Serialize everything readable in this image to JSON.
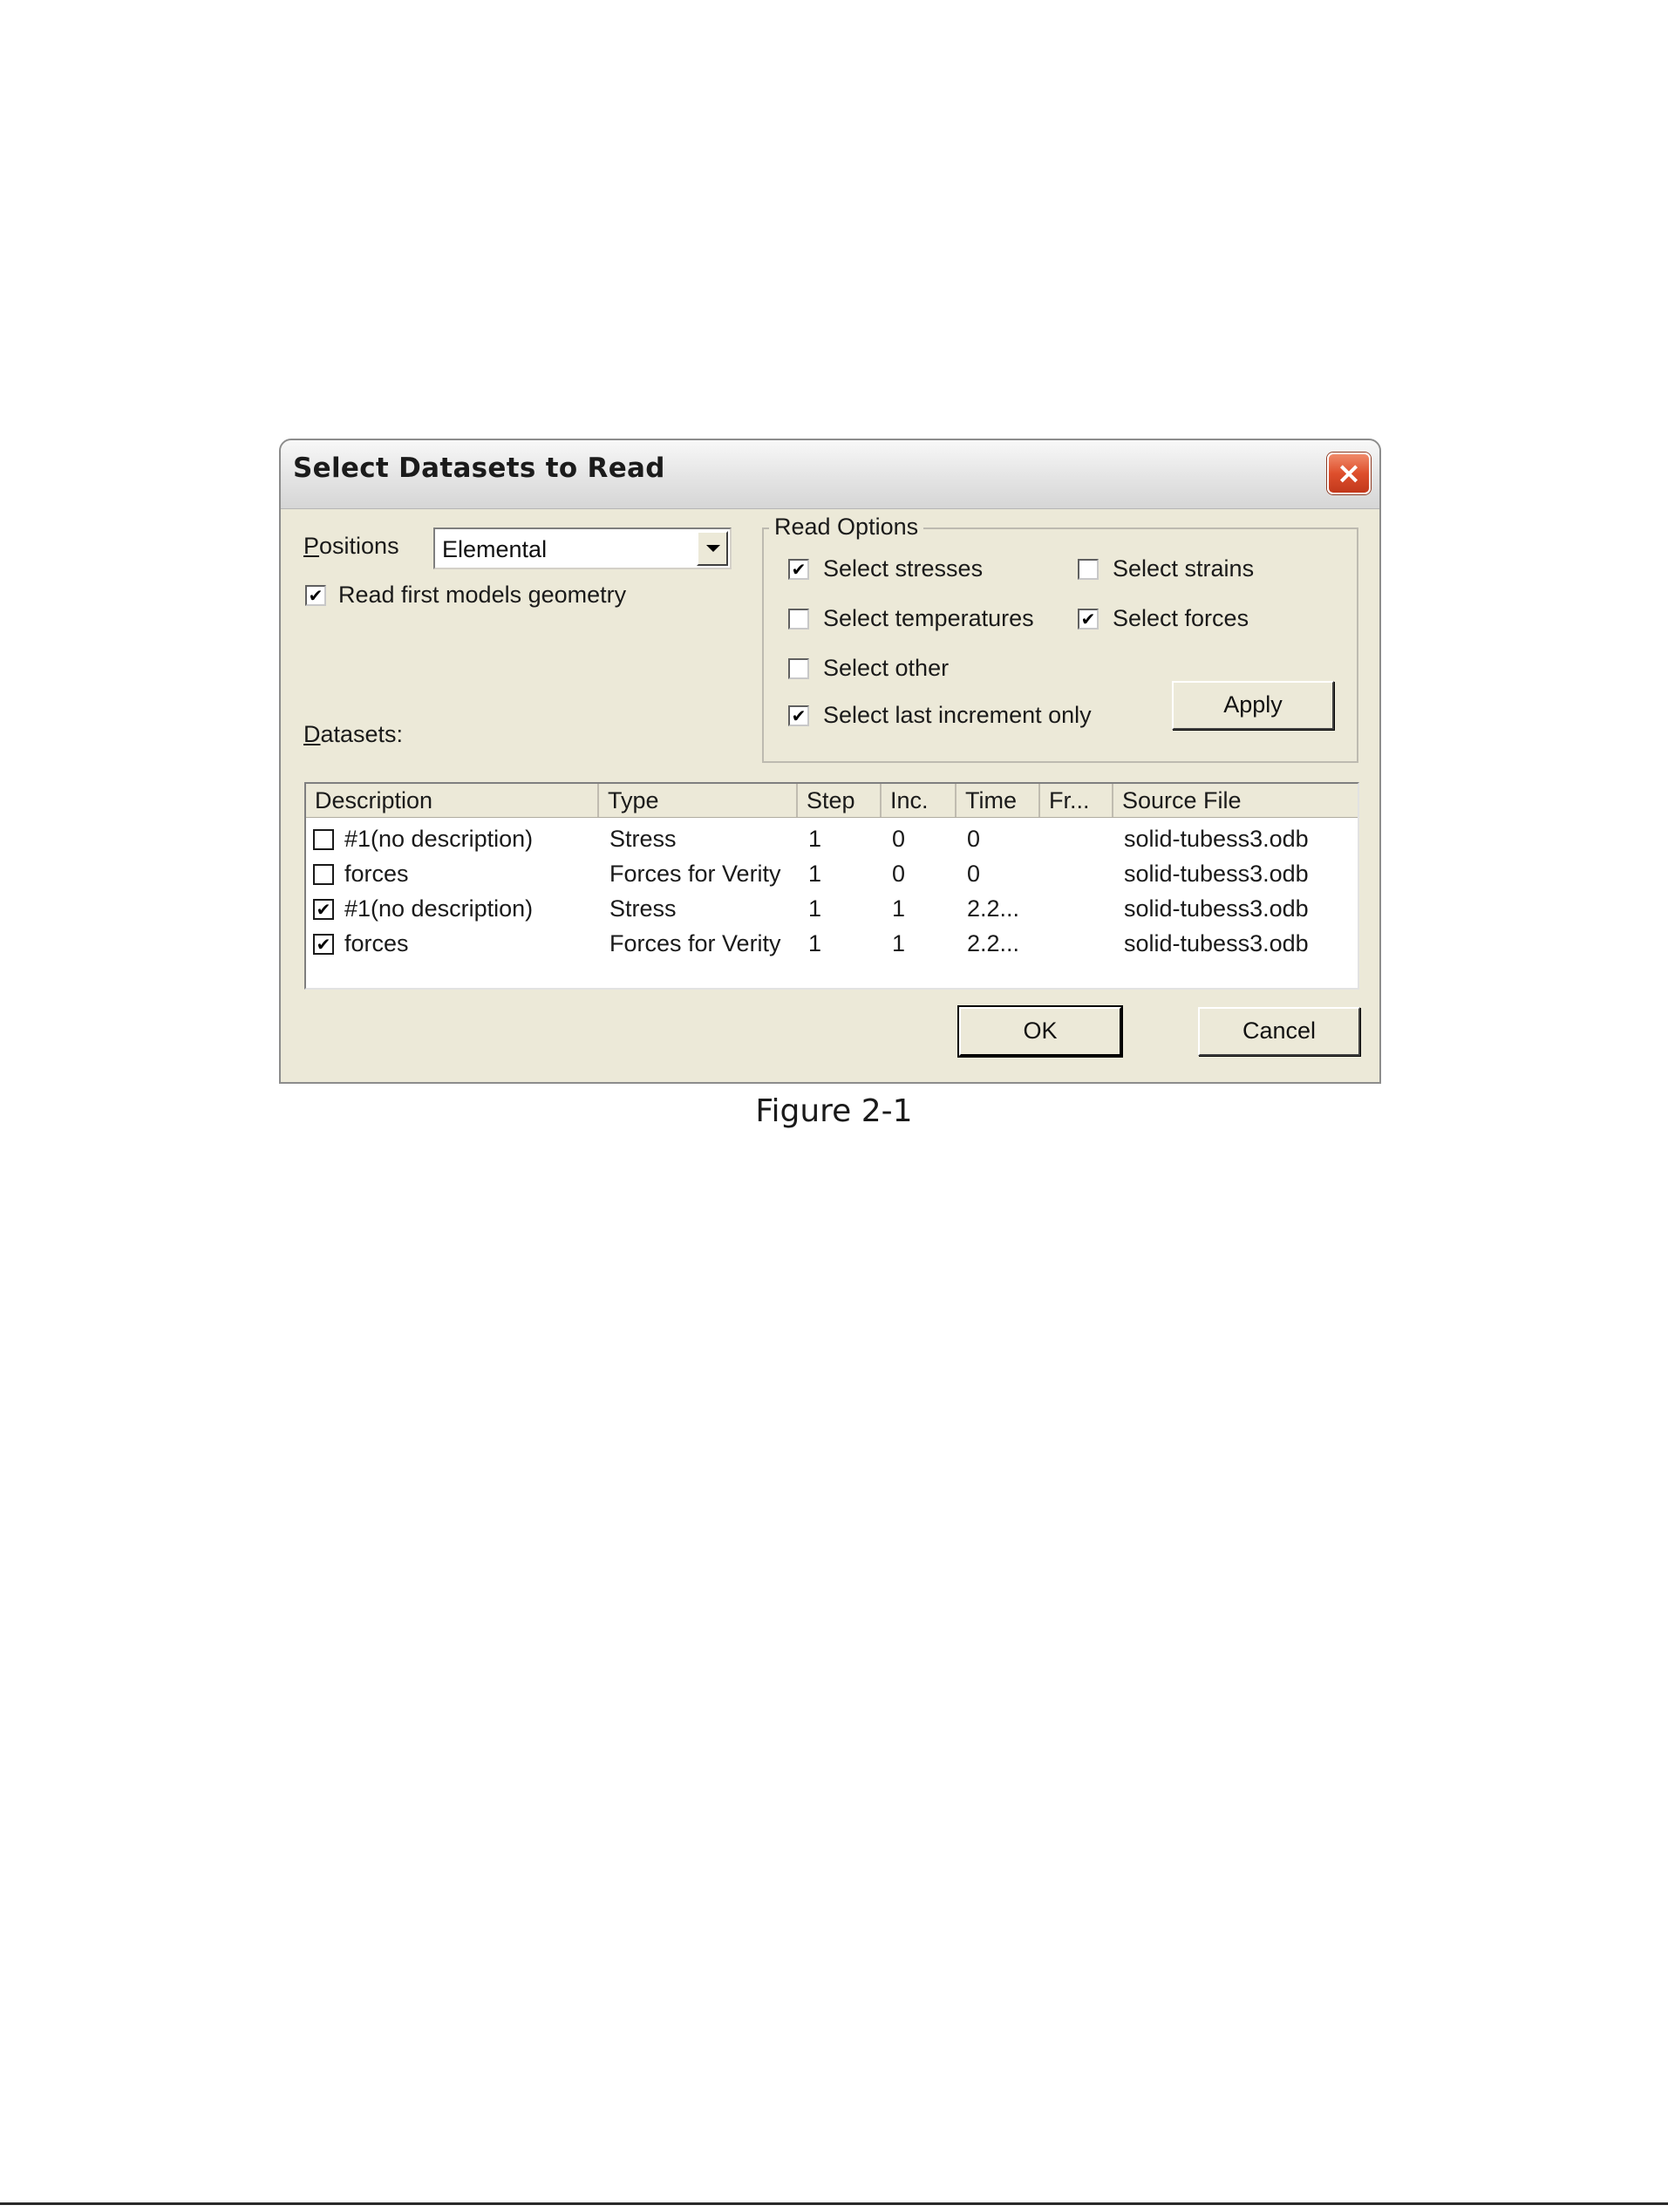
{
  "dialog": {
    "title": "Select Datasets to Read",
    "close_symbol": "×",
    "positions": {
      "label": "Positions",
      "label_first": "P",
      "label_rest": "ositions",
      "value": "Elemental"
    },
    "read_geometry": {
      "label": "Read first models geometry",
      "checked": true
    },
    "datasets_label": {
      "first": "D",
      "rest": "atasets:"
    },
    "read_options": {
      "title": "Read Options",
      "stresses": {
        "label": "Select stresses",
        "checked": true
      },
      "strains": {
        "label": "Select strains",
        "checked": false
      },
      "temperatures": {
        "label": "Select temperatures",
        "checked": false
      },
      "forces": {
        "label": "Select forces",
        "checked": true
      },
      "other": {
        "label": "Select other",
        "checked": false
      },
      "last_increment": {
        "label": "Select last increment only",
        "checked": true
      },
      "apply_label": "Apply"
    },
    "table": {
      "columns": [
        "Description",
        "Type",
        "Step",
        "Inc.",
        "Time",
        "Fr...",
        "Source File"
      ],
      "rows": [
        {
          "checked": false,
          "description": "#1(no description)",
          "type": "Stress",
          "step": "1",
          "inc": "0",
          "time": "0",
          "fr": "",
          "source": "solid-tubess3.odb"
        },
        {
          "checked": false,
          "description": "forces",
          "type": "Forces for Verity",
          "step": "1",
          "inc": "0",
          "time": "0",
          "fr": "",
          "source": "solid-tubess3.odb"
        },
        {
          "checked": true,
          "description": "#1(no description)",
          "type": "Stress",
          "step": "1",
          "inc": "1",
          "time": "2.2...",
          "fr": "",
          "source": "solid-tubess3.odb"
        },
        {
          "checked": true,
          "description": "forces",
          "type": "Forces for Verity",
          "step": "1",
          "inc": "1",
          "time": "2.2...",
          "fr": "",
          "source": "solid-tubess3.odb"
        }
      ]
    },
    "ok_label": "OK",
    "cancel_label": "Cancel"
  },
  "caption": "Figure 2-1",
  "check_mark": "✔"
}
